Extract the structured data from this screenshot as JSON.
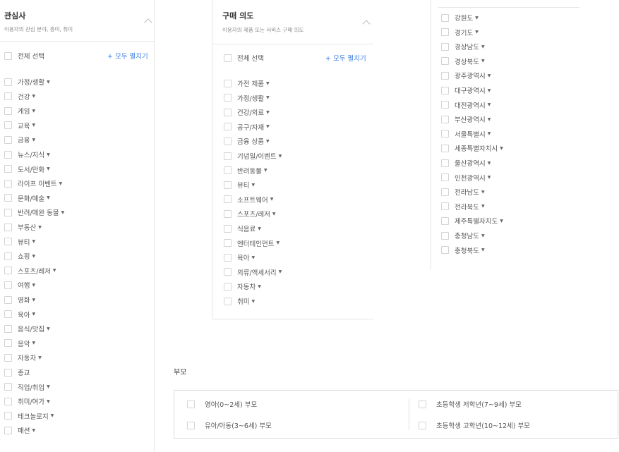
{
  "interest": {
    "title": "관심사",
    "desc": "이용자의 관심 분야, 흥미, 취미",
    "select_all": "전체 선택",
    "expand_all": "+ 모두 펼치기",
    "items": [
      {
        "label": "가정/생활",
        "arrow": true
      },
      {
        "label": "건강",
        "arrow": true
      },
      {
        "label": "게임",
        "arrow": true
      },
      {
        "label": "교육",
        "arrow": true
      },
      {
        "label": "금융",
        "arrow": true
      },
      {
        "label": "뉴스/지식",
        "arrow": true
      },
      {
        "label": "도서/만화",
        "arrow": true
      },
      {
        "label": "라이프 이벤트",
        "arrow": true
      },
      {
        "label": "문화/예술",
        "arrow": true
      },
      {
        "label": "반려/애완 동물",
        "arrow": true
      },
      {
        "label": "부동산",
        "arrow": true
      },
      {
        "label": "뷰티",
        "arrow": true
      },
      {
        "label": "쇼핑",
        "arrow": true
      },
      {
        "label": "스포츠/레저",
        "arrow": true
      },
      {
        "label": "여행",
        "arrow": true
      },
      {
        "label": "영화",
        "arrow": true
      },
      {
        "label": "육아",
        "arrow": true
      },
      {
        "label": "음식/맛집",
        "arrow": true
      },
      {
        "label": "음악",
        "arrow": true
      },
      {
        "label": "자동차",
        "arrow": true
      },
      {
        "label": "종교",
        "arrow": false
      },
      {
        "label": "직업/취업",
        "arrow": true
      },
      {
        "label": "취미/여가",
        "arrow": true
      },
      {
        "label": "테크놀로지",
        "arrow": true
      },
      {
        "label": "패션",
        "arrow": true
      }
    ]
  },
  "purchase": {
    "title": "구매 의도",
    "desc": "이용자의 제품 또는 서비스 구매 의도",
    "select_all": "전체 선택",
    "expand_all": "+ 모두 펼치기",
    "items": [
      {
        "label": "가전 제품",
        "arrow": true
      },
      {
        "label": "가정/생활",
        "arrow": true
      },
      {
        "label": "건강/의료",
        "arrow": true
      },
      {
        "label": "공구/자재",
        "arrow": true
      },
      {
        "label": "금융 상품",
        "arrow": true
      },
      {
        "label": "기념일/이벤트",
        "arrow": true
      },
      {
        "label": "반려동물",
        "arrow": true
      },
      {
        "label": "뷰티",
        "arrow": true
      },
      {
        "label": "소프트웨어",
        "arrow": true
      },
      {
        "label": "스포츠/레저",
        "arrow": true
      },
      {
        "label": "식음료",
        "arrow": true
      },
      {
        "label": "엔터테인먼트",
        "arrow": true
      },
      {
        "label": "육아",
        "arrow": true
      },
      {
        "label": "의류/액세서리",
        "arrow": true
      },
      {
        "label": "자동차",
        "arrow": true
      },
      {
        "label": "취미",
        "arrow": true
      }
    ]
  },
  "region": {
    "items": [
      {
        "label": "강원도",
        "arrow": true
      },
      {
        "label": "경기도",
        "arrow": true
      },
      {
        "label": "경상남도",
        "arrow": true
      },
      {
        "label": "경상북도",
        "arrow": true
      },
      {
        "label": "광주광역시",
        "arrow": true
      },
      {
        "label": "대구광역시",
        "arrow": true
      },
      {
        "label": "대전광역시",
        "arrow": true
      },
      {
        "label": "부산광역시",
        "arrow": true
      },
      {
        "label": "서울특별시",
        "arrow": true
      },
      {
        "label": "세종특별자치시",
        "arrow": true
      },
      {
        "label": "울산광역시",
        "arrow": true
      },
      {
        "label": "인천광역시",
        "arrow": true
      },
      {
        "label": "전라남도",
        "arrow": true
      },
      {
        "label": "전라북도",
        "arrow": true
      },
      {
        "label": "제주특별자치도",
        "arrow": true
      },
      {
        "label": "충청남도",
        "arrow": true
      },
      {
        "label": "충청북도",
        "arrow": true
      }
    ]
  },
  "parent": {
    "title": "부모",
    "options": [
      {
        "label": "영아(0~2세) 부모"
      },
      {
        "label": "유아/아동(3~6세) 부모"
      },
      {
        "label": "초등학생 저학년(7~9세) 부모"
      },
      {
        "label": "초등학생 고학년(10~12세) 부모"
      }
    ]
  },
  "arrow_glyph": "▼",
  "colors": {
    "accent": "#3b7de0",
    "border": "#e6e6e6",
    "checkbox_border": "#d4d4d4"
  }
}
